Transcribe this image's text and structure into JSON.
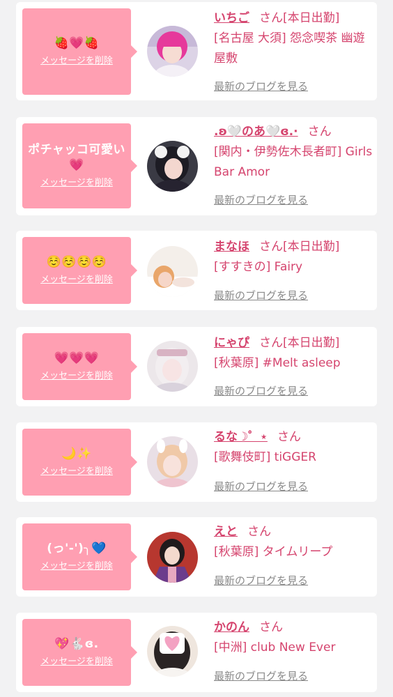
{
  "entries": [
    {
      "message": "🍓💗🍓",
      "delete_label": "メッセージを削除",
      "name": "いちご",
      "honorific": "さん",
      "status": "[本日出勤]",
      "shop": "[名古屋 大須] 怨念喫茶 幽遊屋敷",
      "blog_label": "最新のブログを見る"
    },
    {
      "message": "ポチャッコ可愛い💗",
      "delete_label": "メッセージを削除",
      "name": ".ʚ🤍のあ🤍ɞ.·",
      "honorific": "さん",
      "status": "",
      "shop": "[関内・伊勢佐木長者町] Girls Bar Amor",
      "blog_label": "最新のブログを見る"
    },
    {
      "message": "☺️☺️☺️☺️",
      "delete_label": "メッセージを削除",
      "name": "まなほ",
      "honorific": "さん",
      "status": "[本日出勤]",
      "shop": "[すすきの] Fairy",
      "blog_label": "最新のブログを見る"
    },
    {
      "message": "💗💗💗",
      "delete_label": "メッセージを削除",
      "name": "にゃぴ",
      "honorific": "さん",
      "status": "[本日出勤]",
      "shop": "[秋葉原] #Melt asleep",
      "blog_label": "最新のブログを見る"
    },
    {
      "message": "🌙✨",
      "delete_label": "メッセージを削除",
      "name": "るな☽゜⋆",
      "honorific": "さん",
      "status": "",
      "shop": "[歌舞伎町] tiGGER",
      "blog_label": "最新のブログを見る"
    },
    {
      "message": "(っ'-')╮💙",
      "delete_label": "メッセージを削除",
      "name": "えと",
      "honorific": "さん",
      "status": "",
      "shop": "[秋葉原] タイムリープ",
      "blog_label": "最新のブログを見る"
    },
    {
      "message": "💖🐇ɞ.",
      "delete_label": "メッセージを削除",
      "name": "かのん",
      "honorific": "さん",
      "status": "",
      "shop": "[中洲] club New Ever",
      "blog_label": "最新のブログを見る"
    }
  ],
  "colors": {
    "page_background": "#f2f2f3",
    "card_background": "#ffffff",
    "bubble": "#ff9fb2",
    "accent_text": "#d5446e",
    "link_gray": "#8a8a8a"
  }
}
